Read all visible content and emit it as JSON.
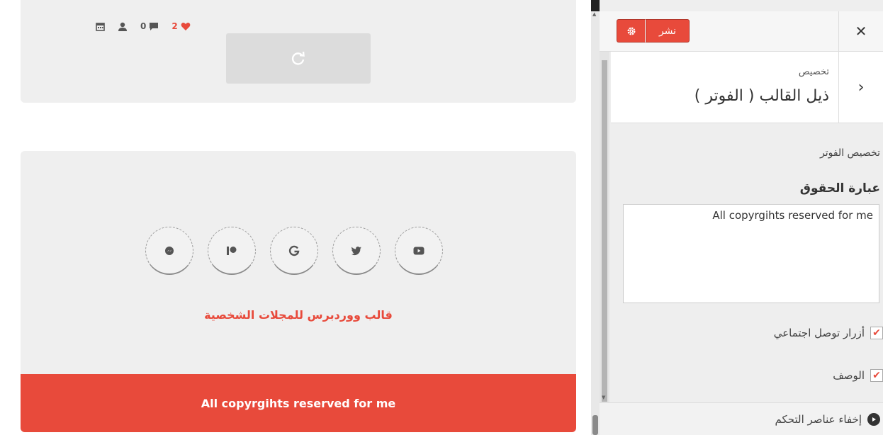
{
  "preview": {
    "meta": {
      "comments": "0",
      "likes": "2"
    },
    "tagline": "قالب ووردبرس للمجلات الشخصية",
    "copyright": "All copyrgihts reserved for me",
    "socials": [
      "messenger-icon",
      "patreon-icon",
      "google-icon",
      "twitter-icon",
      "youtube-icon"
    ],
    "colors": {
      "accent": "#e84a3b",
      "card": "#efefef"
    }
  },
  "panel": {
    "publish_label": "نشر",
    "section_small": "تخصيص",
    "section_title": "ذيل القالب ( الفوتر )",
    "field_desc": "تخصيص الفوتر",
    "field_label": "عبارة الحقوق",
    "copyright_value": "All copyrgihts reserved for me",
    "checkboxes": [
      {
        "label": "أزرار توصل اجتماعي",
        "checked": true
      },
      {
        "label": "الوصف",
        "checked": true
      }
    ],
    "hide_controls_label": "إخفاء عناصر التحكم"
  }
}
